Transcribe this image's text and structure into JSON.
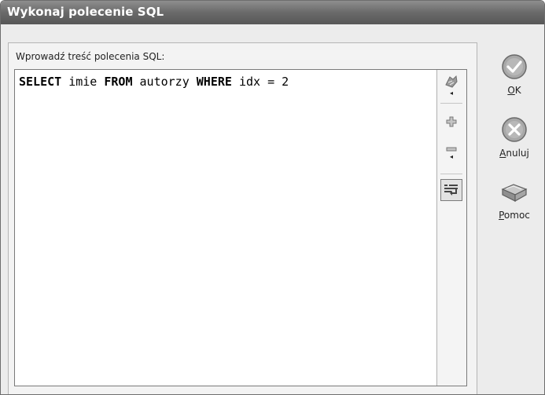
{
  "window": {
    "title": "Wykonaj polecenie SQL"
  },
  "prompt_label": "Wprowadź treść polecenia SQL:",
  "sql": {
    "tokens": [
      {
        "text": "SELECT",
        "keyword": true
      },
      {
        "text": " imie ",
        "keyword": false
      },
      {
        "text": "FROM",
        "keyword": true
      },
      {
        "text": " autorzy ",
        "keyword": false
      },
      {
        "text": "WHERE",
        "keyword": true
      },
      {
        "text": " idx = 2",
        "keyword": false
      }
    ]
  },
  "editor_tools": [
    {
      "name": "history-icon",
      "has_dropdown": true
    },
    {
      "name": "add-icon",
      "has_dropdown": false
    },
    {
      "name": "remove-icon",
      "has_dropdown": true
    },
    {
      "name": "word-wrap-icon",
      "pressed": true
    }
  ],
  "buttons": {
    "ok": {
      "mnemonic": "O",
      "rest": "K",
      "icon": "check-icon"
    },
    "cancel": {
      "mnemonic": "A",
      "rest": "nuluj",
      "icon": "cross-icon"
    },
    "help": {
      "mnemonic": "P",
      "rest": "omoc",
      "icon": "book-icon"
    }
  },
  "colors": {
    "titlebar": "#6a6a6a",
    "background": "#ececec",
    "icon_gray": "#8a8a8a"
  }
}
